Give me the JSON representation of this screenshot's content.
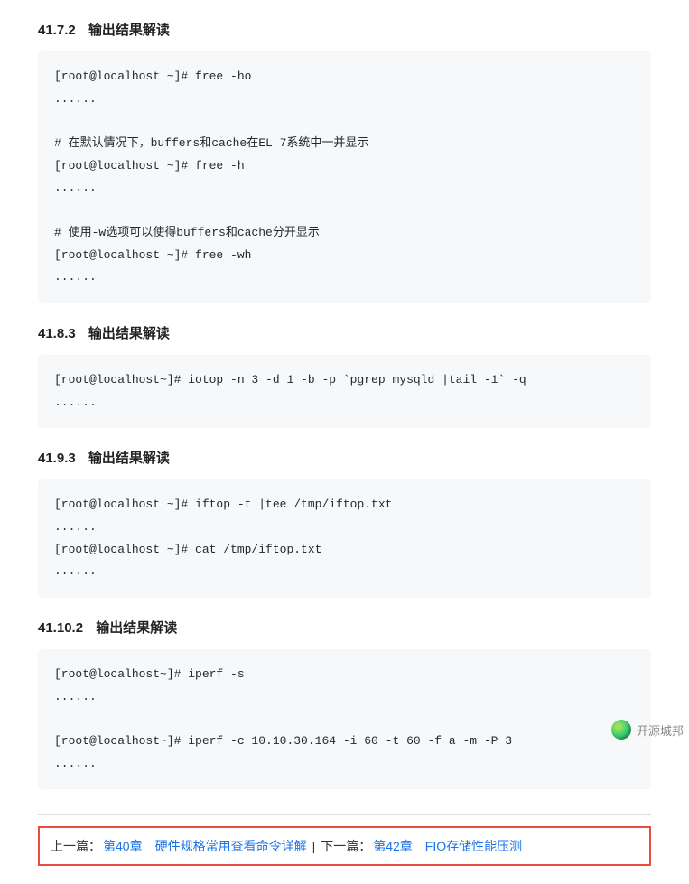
{
  "sections": [
    {
      "num": "41.7.2",
      "title": "输出结果解读",
      "code": "[root@localhost ~]# free -ho\n......\n\n# 在默认情况下，buffers和cache在EL 7系统中一并显示\n[root@localhost ~]# free -h\n......\n\n# 使用-w选项可以使得buffers和cache分开显示\n[root@localhost ~]# free -wh\n......"
    },
    {
      "num": "41.8.3",
      "title": "输出结果解读",
      "code": "[root@localhost~]# iotop -n 3 -d 1 -b -p `pgrep mysqld |tail -1` -q\n......"
    },
    {
      "num": "41.9.3",
      "title": "输出结果解读",
      "code": "[root@localhost ~]# iftop -t |tee /tmp/iftop.txt\n......\n[root@localhost ~]# cat /tmp/iftop.txt\n......"
    },
    {
      "num": "41.10.2",
      "title": "输出结果解读",
      "code": "[root@localhost~]# iperf -s\n......\n\n[root@localhost~]# iperf -c 10.10.30.164 -i 60 -t 60 -f a -m -P 3\n......"
    }
  ],
  "nav": {
    "prev_label": "上一篇：",
    "prev_link": "第40章　硬件规格常用查看命令详解",
    "separator": " | ",
    "next_label": "下一篇：",
    "next_link": "第42章　FIO存储性能压测"
  },
  "watermark": {
    "text": "开源城邦"
  }
}
